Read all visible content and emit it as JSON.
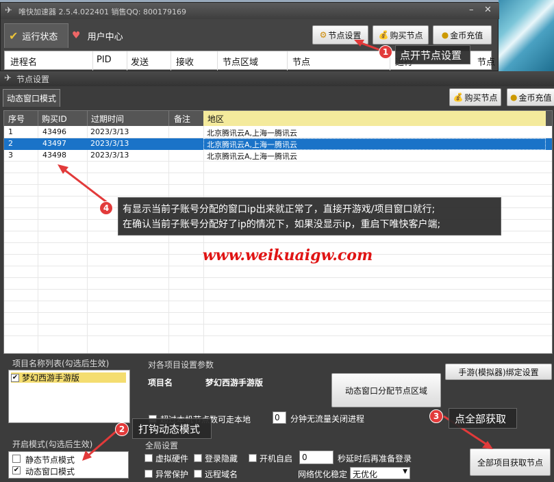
{
  "main_window": {
    "title": "唯快加速器 2.5.4.022401  销售QQ: 800179169",
    "tabs": [
      {
        "label": "运行状态"
      },
      {
        "label": "用户中心"
      }
    ],
    "buttons": {
      "node_settings": "节点设置",
      "buy_node": "购买节点",
      "recharge": "金币充值"
    },
    "columns": [
      "进程名",
      "PID",
      "发送",
      "接收",
      "节点区域",
      "节点",
      "运行",
      "节点"
    ]
  },
  "node_window": {
    "title": "节点设置",
    "mode_tab": "动态窗口模式",
    "buttons": {
      "buy_node": "购买节点",
      "recharge": "金币充值"
    },
    "grid": {
      "headers": [
        "序号",
        "购买ID",
        "过期时间",
        "备注",
        "地区"
      ],
      "rows": [
        {
          "no": "1",
          "id": "43496",
          "expire": "2023/3/13",
          "note": "",
          "region": "北京腾讯云A,上海一腾讯云"
        },
        {
          "no": "2",
          "id": "43497",
          "expire": "2023/3/13",
          "note": "",
          "region": "北京腾讯云A,上海一腾讯云"
        },
        {
          "no": "3",
          "id": "43498",
          "expire": "2023/3/13",
          "note": "",
          "region": "北京腾讯云A,上海一腾讯云"
        }
      ],
      "selected_index": 1
    },
    "project_list": {
      "title": "项目名称列表(勾选后生效)",
      "items": [
        {
          "label": "梦幻西游手游版",
          "checked": true
        }
      ]
    },
    "project_params": {
      "title": "对各项目设置参数",
      "project_name_label": "项目名",
      "project_name_value": "梦幻西游手游版",
      "assign_button": "动态窗口分配节点区域",
      "bind_button": "手游(模拟器)绑定设置",
      "exceed_label": "超过本机节点数可走本地",
      "idle_value": "0",
      "idle_label": "分钟无流量关闭进程"
    },
    "mode": {
      "title": "开启模式(勾选后生效)",
      "static": "静态节点模式",
      "static_checked": false,
      "dynamic": "动态窗口模式",
      "dynamic_checked": true
    },
    "global": {
      "title": "全局设置",
      "virtual_hw": "虚拟硬件",
      "login_hide": "登录隐藏",
      "auto_start": "开机自启",
      "delay_value": "0",
      "delay_label": "秒延时后再准备登录",
      "abnormal": "异常保护",
      "remote_domain": "远程域名",
      "net_opt_label": "网络优化稳定",
      "net_opt_value": "无优化",
      "fetch_all": "全部项目获取节点"
    }
  },
  "annotations": {
    "c1": {
      "num": "1",
      "text": "点开节点设置"
    },
    "c2": {
      "num": "2",
      "text": "打钩动态模式"
    },
    "c3": {
      "num": "3",
      "text": "点全部获取"
    },
    "c4": {
      "num": "4",
      "line1": "有显示当前子账号分配的窗口ip出来就正常了，直接开游戏/项目窗口就行;",
      "line2": "在确认当前子账号分配好了ip的情况下，如果没显示ip，重启下唯快客户端;"
    },
    "watermark": "www.weikuaigw.com"
  },
  "colors": {
    "selected_row": "#1a73c8",
    "area_header": "#f4ea9c",
    "callout_badge": "#e23a3a",
    "watermark": "#e01414"
  }
}
